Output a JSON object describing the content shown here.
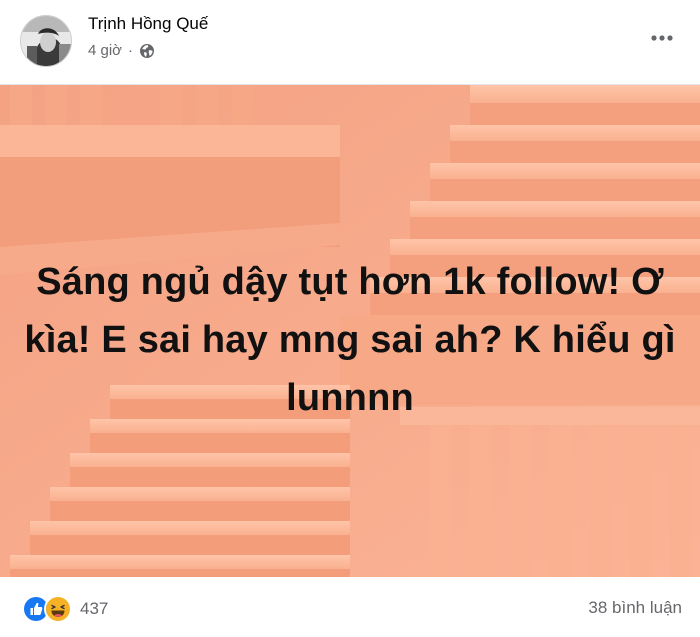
{
  "post": {
    "author": {
      "name": "Trịnh Hồng Quế",
      "avatar_icon": "avatar-photo"
    },
    "meta": {
      "time": "4 giờ",
      "separator": "·",
      "privacy_icon": "globe-icon"
    },
    "more_icon": "more-horizontal-icon",
    "image": {
      "text": "Sáng ngủ dậy tụt hơn 1k follow! Ơ kìa! E sai hay mng sai ah? K hiểu gì lunnnn",
      "background_color": "#f7a989"
    },
    "reactions": {
      "icons": [
        "like-icon",
        "haha-icon"
      ],
      "count": "437"
    },
    "comments": {
      "label": "38 bình luận"
    }
  }
}
